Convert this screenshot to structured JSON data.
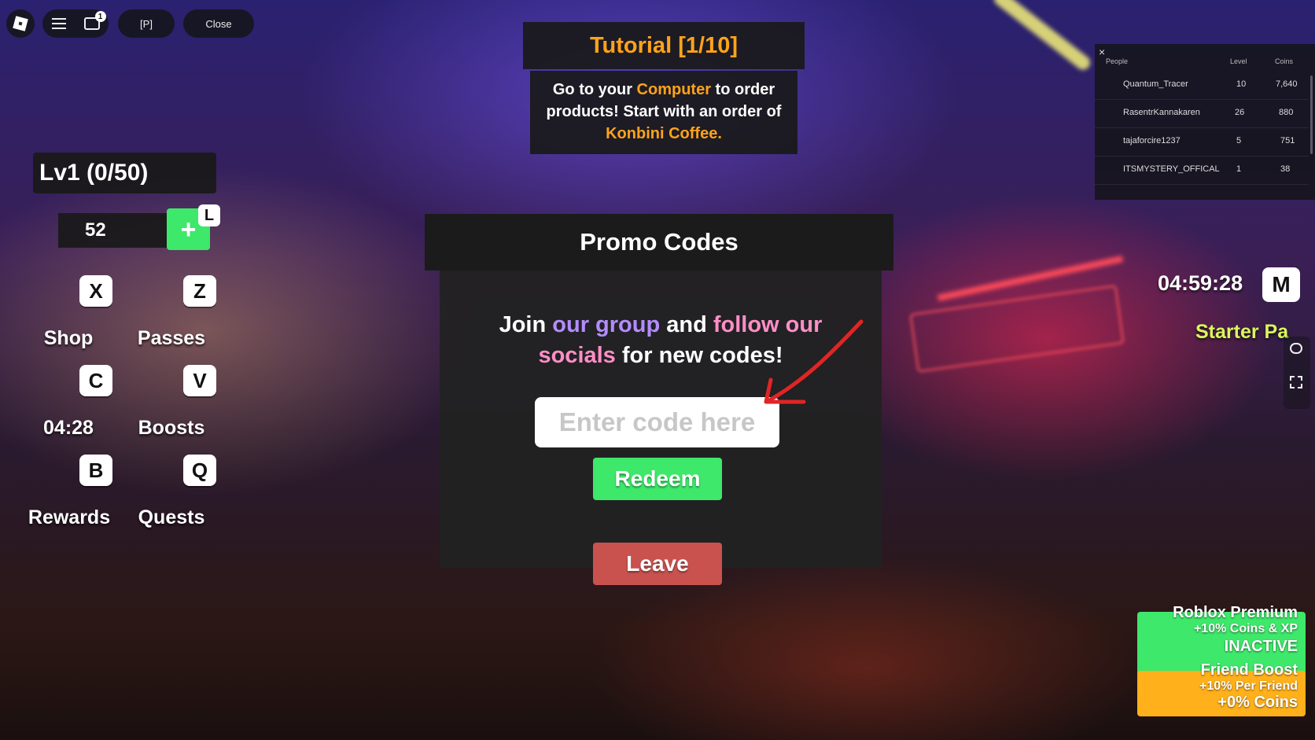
{
  "topbar": {
    "p_label": "[P]",
    "close_label": "Close",
    "chat_badge": "1"
  },
  "tutorial": {
    "title": "Tutorial [1/10]",
    "line1_a": "Go to your ",
    "line1_highlight": "Computer",
    "line1_b": " to order",
    "line2": "products! Start with an order of",
    "line3_highlight": "Konbini Coffee."
  },
  "promo": {
    "title": "Promo Codes",
    "msg_join": "Join ",
    "msg_group": "our group",
    "msg_and": " and ",
    "msg_follow": "follow our",
    "msg_socials": "socials",
    "msg_end": " for new codes!",
    "input_placeholder": "Enter code here",
    "redeem_label": "Redeem",
    "leave_label": "Leave"
  },
  "player": {
    "level_text": "Lv1 (0/50)",
    "coins": "52",
    "add_key": "L"
  },
  "hotkeys": [
    {
      "key": "X",
      "label": "Shop"
    },
    {
      "key": "Z",
      "label": "Passes"
    },
    {
      "key": "C",
      "label": "04:28"
    },
    {
      "key": "V",
      "label": "Boosts"
    },
    {
      "key": "B",
      "label": "Rewards"
    },
    {
      "key": "Q",
      "label": "Quests"
    }
  ],
  "leaderboard": {
    "headers": {
      "people": "People",
      "level": "Level",
      "coins": "Coins"
    },
    "rows": [
      {
        "name": "Quantum_Tracer",
        "level": "10",
        "coins": "7,640"
      },
      {
        "name": "RasentrKannakaren",
        "level": "26",
        "coins": "880"
      },
      {
        "name": "tajaforcire1237",
        "level": "5",
        "coins": "751"
      },
      {
        "name": "ITSMYSTERY_OFFICAL",
        "level": "1",
        "coins": "38"
      }
    ]
  },
  "timer": "04:59:28",
  "map_key": "M",
  "starter_pack": "Starter Pa",
  "boosts": {
    "premium": {
      "title": "Roblox Premium",
      "line1": "+10% Coins & XP",
      "status": "INACTIVE"
    },
    "friend": {
      "title": "Friend Boost",
      "line1": "+10% Per Friend",
      "line2": "+0% Coins"
    }
  },
  "colors": {
    "accent_orange": "#ffa31a",
    "accent_purple": "#b48cff",
    "accent_pink": "#ff8ec6",
    "green": "#3ee86a",
    "leave_red": "#c9524f"
  }
}
